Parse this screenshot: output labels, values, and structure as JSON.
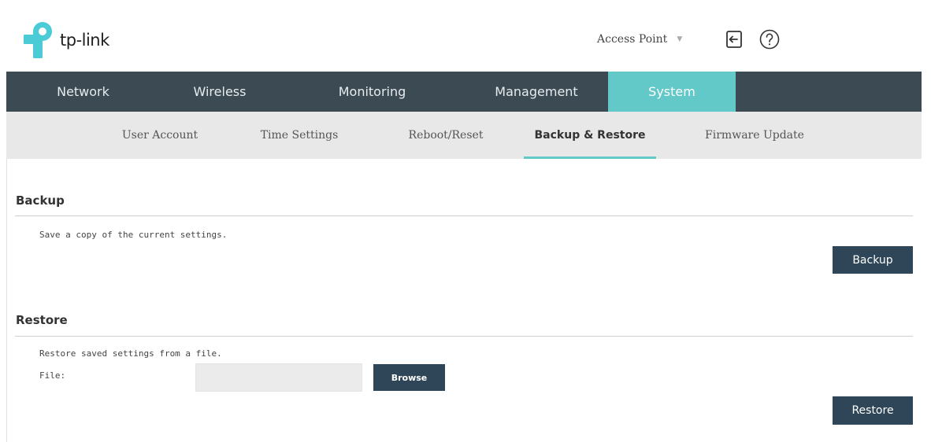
{
  "header": {
    "logo_text": "tp-link",
    "mode": "Access Point"
  },
  "main_nav": {
    "tabs": [
      {
        "label": "Network",
        "active": false
      },
      {
        "label": "Wireless",
        "active": false
      },
      {
        "label": "Monitoring",
        "active": false
      },
      {
        "label": "Management",
        "active": false
      },
      {
        "label": "System",
        "active": true
      }
    ]
  },
  "sub_nav": {
    "tabs": [
      {
        "label": "User Account",
        "active": false
      },
      {
        "label": "Time Settings",
        "active": false
      },
      {
        "label": "Reboot/Reset",
        "active": false
      },
      {
        "label": "Backup & Restore",
        "active": true
      },
      {
        "label": "Firmware Update",
        "active": false
      }
    ]
  },
  "backup": {
    "title": "Backup",
    "description": "Save a copy of the current settings.",
    "button_label": "Backup"
  },
  "restore": {
    "title": "Restore",
    "description": "Restore saved settings from a file.",
    "file_label": "File:",
    "file_value": "",
    "browse_label": "Browse",
    "button_label": "Restore"
  },
  "colors": {
    "nav_bg": "#3c4a53",
    "accent": "#62c8c8",
    "button_bg": "#2e4657",
    "subnav_bg": "#e8e8e8"
  },
  "icons": {
    "logo": "tp-link-logo-icon",
    "logout": "logout-icon",
    "help": "help-icon",
    "dropdown": "chevron-down-icon"
  }
}
